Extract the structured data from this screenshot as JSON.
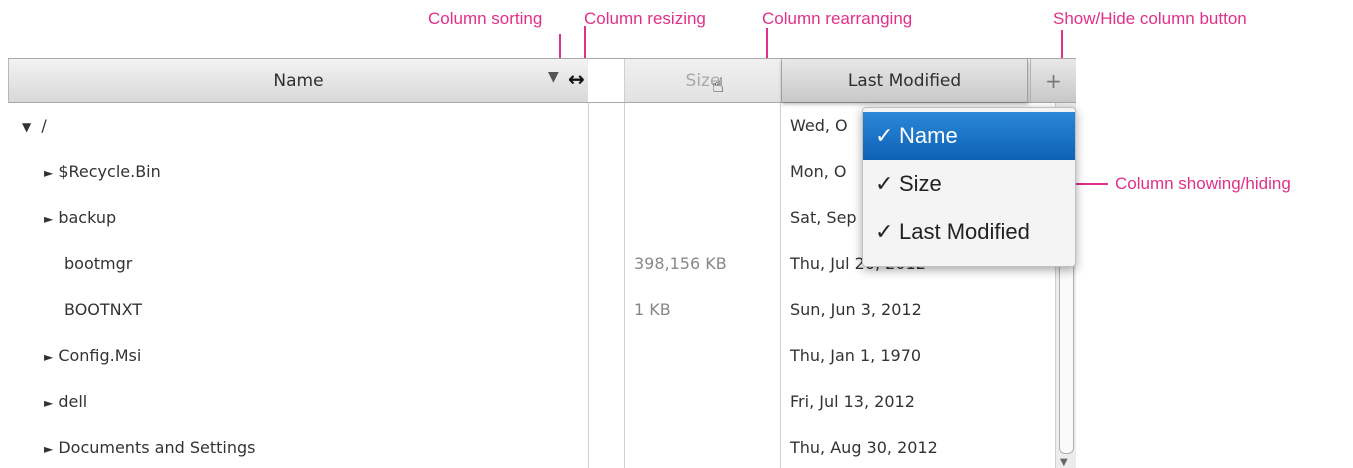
{
  "annotations": {
    "sorting": "Column sorting",
    "resizing": "Column resizing",
    "rearranging": "Column rearranging",
    "show_hide_button": "Show/Hide column button",
    "showing_hiding": "Column showing/hiding"
  },
  "header": {
    "name": "Name",
    "size": "Size",
    "last_modified": "Last Modified",
    "plus": "+",
    "sort_glyph": "▼",
    "resize_glyph": "↔"
  },
  "rows": [
    {
      "toggle": "▼",
      "name": "/",
      "size": "",
      "lm": "Wed, O"
    },
    {
      "toggle": "►",
      "name": "$Recycle.Bin",
      "size": "",
      "lm": "Mon, O"
    },
    {
      "toggle": "►",
      "name": "backup",
      "size": "",
      "lm": "Sat, Sep"
    },
    {
      "toggle": "",
      "name": "bootmgr",
      "size": "398,156 KB",
      "lm": "Thu, Jul 26, 2012"
    },
    {
      "toggle": "",
      "name": "BOOTNXT",
      "size": "1 KB",
      "lm": "Sun, Jun 3, 2012"
    },
    {
      "toggle": "►",
      "name": "Config.Msi",
      "size": "",
      "lm": "Thu, Jan 1, 1970"
    },
    {
      "toggle": "►",
      "name": "dell",
      "size": "",
      "lm": "Fri, Jul 13, 2012"
    },
    {
      "toggle": "►",
      "name": "Documents and Settings",
      "size": "",
      "lm": "Thu, Aug 30, 2012"
    }
  ],
  "menu": {
    "items": [
      {
        "check": "✓",
        "label": "Name"
      },
      {
        "check": "✓",
        "label": "Size"
      },
      {
        "check": "✓",
        "label": "Last Modified"
      }
    ]
  },
  "icons": {
    "hand": "hand-cursor-icon"
  },
  "colors": {
    "annotation": "#e0308a",
    "selection": "#1a72c4"
  }
}
